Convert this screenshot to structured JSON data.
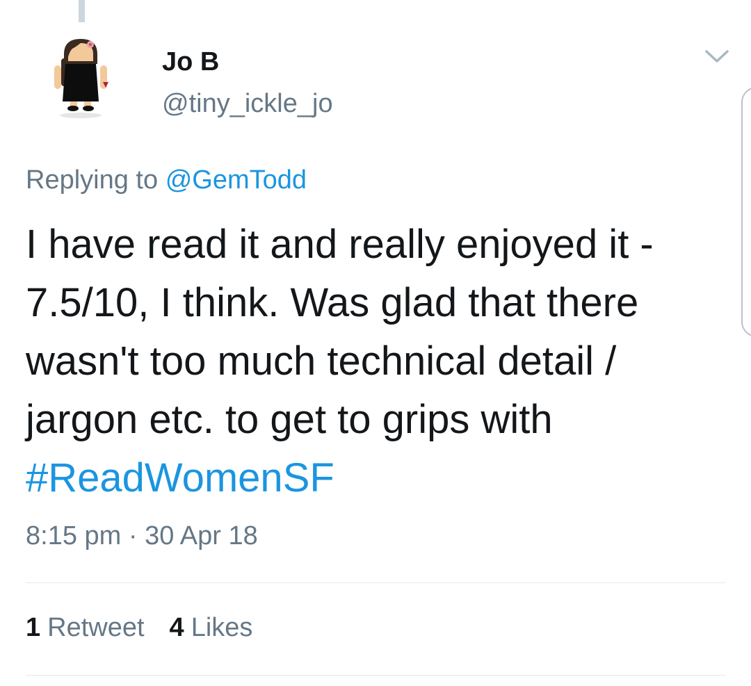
{
  "tweet": {
    "author": {
      "name": "Jo B",
      "handle": "@tiny_ickle_jo",
      "avatar_icon": "android-girl-avatar"
    },
    "reply_context": {
      "prefix": "Replying to",
      "mention": "@GemTodd"
    },
    "text_lines": [
      "I have read it and really enjoyed it -",
      "7.5/10, I think. Was glad that there",
      "wasn't too much technical detail /",
      "jargon etc. to get to grips with"
    ],
    "hashtag": "#ReadWomenSF",
    "timestamp": "8:15 pm · 30 Apr 18",
    "stats": {
      "retweets_count": "1",
      "retweets_label": "Retweet",
      "likes_count": "4",
      "likes_label": "Likes"
    },
    "menu_icon": "chevron-down-icon"
  },
  "colors": {
    "link": "#1b95e0",
    "secondary_text": "#657786",
    "primary_text": "#14171a",
    "divider": "#e1e8ed"
  }
}
